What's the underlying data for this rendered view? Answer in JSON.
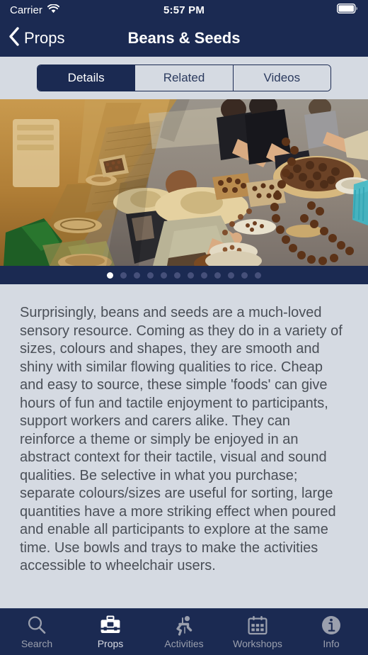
{
  "status_bar": {
    "carrier": "Carrier",
    "wifi_icon": "wifi-icon",
    "time": "5:57 PM",
    "battery_icon": "battery-full-icon"
  },
  "nav_bar": {
    "back_icon": "chevron-left-icon",
    "back_label": "Props",
    "title": "Beans & Seeds"
  },
  "segmented_control": {
    "selected_index": 0,
    "segments": [
      {
        "label": "Details"
      },
      {
        "label": "Related"
      },
      {
        "label": "Videos"
      }
    ]
  },
  "gallery": {
    "image_alt": "People seated on floor arranging beans and seeds in bowls and trays",
    "total_pages": 12,
    "current_page": 1
  },
  "details": {
    "body": "Surprisingly, beans and seeds are a much-loved sensory resource. Coming as they do in a variety of sizes, colours and shapes, they are smooth and shiny with similar flowing qualities to rice. Cheap and easy to source, these simple 'foods' can give hours of fun and tactile enjoyment to participants, support workers and carers alike. They can reinforce a theme or simply be enjoyed in an abstract context for their tactile, visual and sound qualities. Be selective in what you purchase; separate colours/sizes are useful for sorting, large quantities have a more striking effect when poured and enable all participants to explore at the same time. Use bowls and trays to make the activities accessible to wheelchair users."
  },
  "tab_bar": {
    "active_index": 1,
    "tabs": [
      {
        "label": "Search",
        "icon": "search-icon"
      },
      {
        "label": "Props",
        "icon": "briefcase-icon"
      },
      {
        "label": "Activities",
        "icon": "running-person-icon"
      },
      {
        "label": "Workshops",
        "icon": "calendar-icon"
      },
      {
        "label": "Info",
        "icon": "info-circle-icon"
      }
    ]
  },
  "colors": {
    "navy": "#1b2a52",
    "background": "#d5dae2",
    "text": "#4a4f57",
    "inactive_tab": "#9a9fad",
    "active_tab": "#ffffff"
  }
}
